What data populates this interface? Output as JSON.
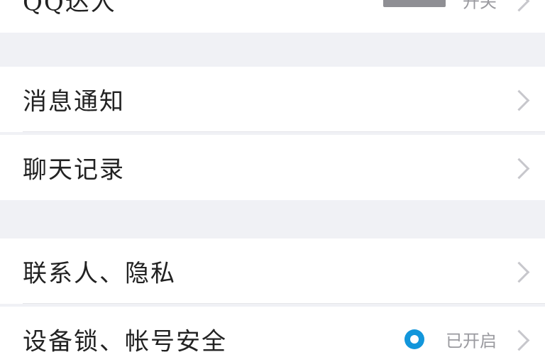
{
  "rows": {
    "top": {
      "label": "QQ达人",
      "status": "开关"
    },
    "notify": {
      "label": "消息通知"
    },
    "chat_history": {
      "label": "聊天记录"
    },
    "contacts_privacy": {
      "label": "联系人、隐私"
    },
    "device_lock": {
      "label": "设备锁、帐号安全",
      "status": "已开启"
    }
  },
  "icons": {
    "chevron": "chevron-right-icon",
    "secure": "shield-check-icon"
  },
  "colors": {
    "background": "#f0f1f5",
    "row": "#ffffff",
    "text": "#222222",
    "muted": "#9a9a9f",
    "accent": "#1296db"
  }
}
